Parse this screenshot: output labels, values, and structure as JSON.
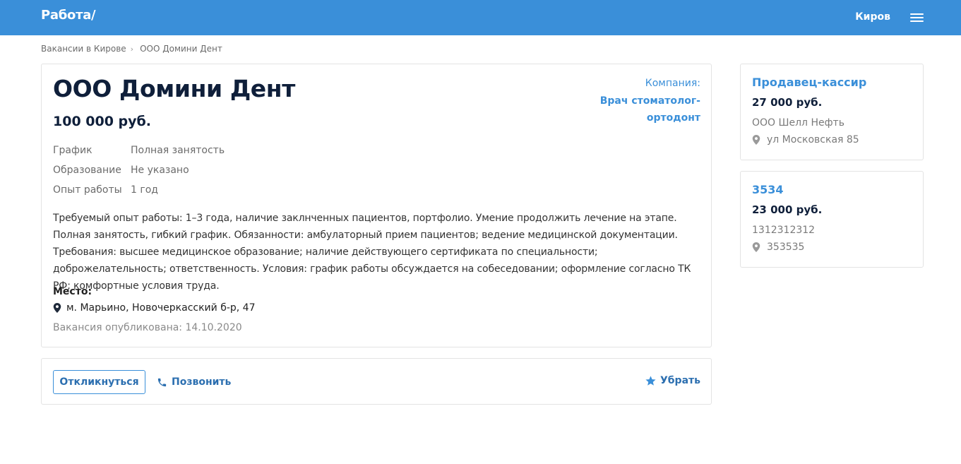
{
  "header": {
    "logo": "Работа/",
    "city": "Киров"
  },
  "breadcrumb": {
    "items": [
      "Вакансии в Кирове",
      "ООО Домини Дент"
    ],
    "separator": "›"
  },
  "vacancy": {
    "title": "ООО Домини Дент",
    "salary": "100 000 руб.",
    "company_label": "Компания:",
    "company_name_line1": "Врач стоматолог-",
    "company_name_line2": "ортодонт",
    "props": [
      {
        "key": "График",
        "value": "Полная занятость"
      },
      {
        "key": "Образование",
        "value": "Не указано"
      },
      {
        "key": "Опыт работы",
        "value": "1 год"
      }
    ],
    "description": "Требуемый опыт работы: 1–3 года, наличие заклнченных пациентов, портфолио. Умение продолжить лечение на этапе. Полная занятость, гибкий график. Обязанности: амбулаторный прием пациентов; ведение медицинской документации. Требования: высшее медицинское образование; наличие действующего сертификата по специальности; доброжелательность; ответственность. Условия: график работы обсуждается на собеседовании; оформление согласно ТК РФ; комфортные условия труда.",
    "place_label": "Место:",
    "address": "м. Марьино, Новочеркасский б-р, 47",
    "published": "Вакансия опубликована: 14.10.2020"
  },
  "actions": {
    "respond": "Откликнуться",
    "call": "Позвонить",
    "remove": "Убрать"
  },
  "sidebar": {
    "cards": [
      {
        "title": "Продавец-кассир",
        "salary": "27 000 руб.",
        "company": "ООО Шелл Нефть",
        "address": "ул Московская 85"
      },
      {
        "title": "3534",
        "salary": "23 000 руб.",
        "company": "1312312312",
        "address": "353535"
      }
    ]
  },
  "colors": {
    "brand": "#3a8fd9",
    "title": "#0f1f3a",
    "link": "#2c6fb0"
  }
}
